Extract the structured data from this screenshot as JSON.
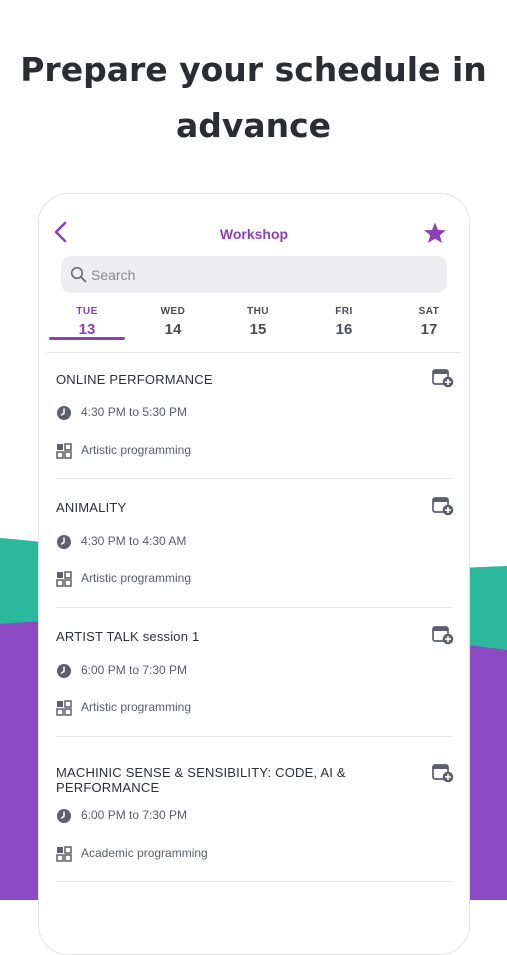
{
  "headline": {
    "line1": "Prepare your schedule in",
    "line2": "advance"
  },
  "colors": {
    "accent": "#8e3fb8",
    "teal": "#2bb89c",
    "purple": "#8c4bc4",
    "text": "#2e3038"
  },
  "topbar": {
    "title": "Workshop",
    "back_icon": "chevron-left-icon",
    "favorite_icon": "star-icon"
  },
  "search": {
    "placeholder": "Search"
  },
  "days": [
    {
      "name": "TUE",
      "date": "13",
      "selected": true
    },
    {
      "name": "WED",
      "date": "14",
      "selected": false
    },
    {
      "name": "THU",
      "date": "15",
      "selected": false
    },
    {
      "name": "FRI",
      "date": "16",
      "selected": false
    },
    {
      "name": "SAT",
      "date": "17",
      "selected": false
    }
  ],
  "events": [
    {
      "title": "ONLINE PERFORMANCE",
      "time": "4:30 PM to 5:30 PM",
      "category": "Artistic programming"
    },
    {
      "title": "ANIMALITY",
      "time": "4:30 PM to 4:30 AM",
      "category": "Artistic programming"
    },
    {
      "title": "ARTIST TALK session 1",
      "time": "6:00 PM to 7:30 PM",
      "category": "Artistic programming"
    },
    {
      "title": "MACHINIC SENSE & SENSIBILITY: CODE, AI & PERFORMANCE",
      "time": "6:00 PM to 7:30 PM",
      "category": "Academic programming"
    }
  ]
}
